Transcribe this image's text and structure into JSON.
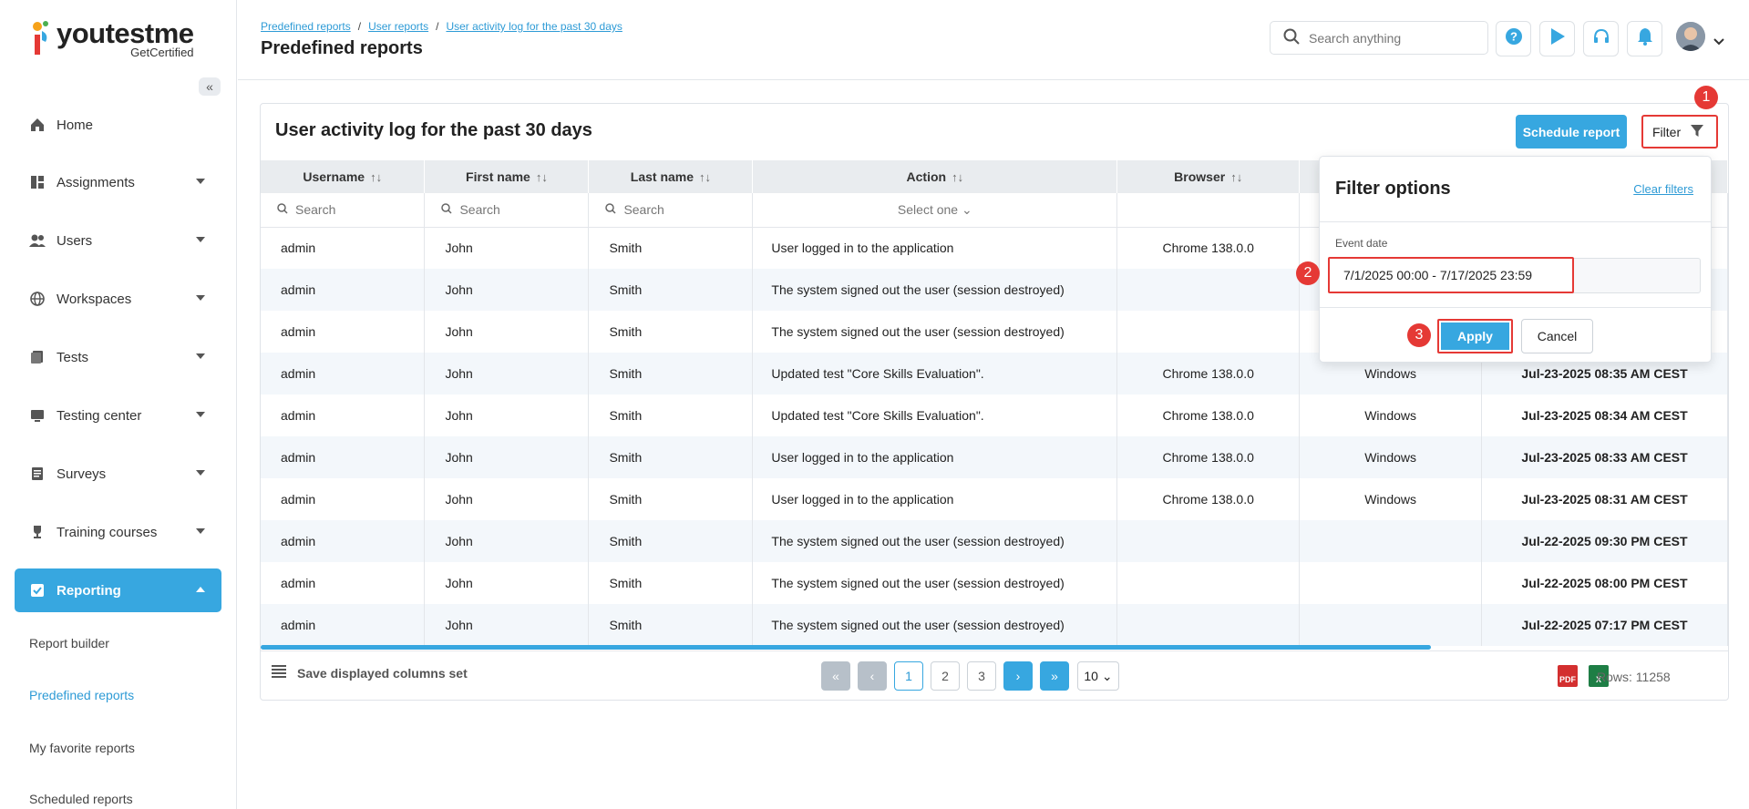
{
  "brand": {
    "name": "youtestme",
    "sub": "GetCertified",
    "accent": "#37a7e0",
    "highlight": "#e53935"
  },
  "sidebar": {
    "collapse_icon": "double-chevron-left-icon",
    "items": [
      {
        "label": "Home",
        "icon": "home-icon"
      },
      {
        "label": "Assignments",
        "icon": "assignments-icon"
      },
      {
        "label": "Users",
        "icon": "users-icon"
      },
      {
        "label": "Workspaces",
        "icon": "globe-icon"
      },
      {
        "label": "Tests",
        "icon": "tests-icon"
      },
      {
        "label": "Testing center",
        "icon": "monitor-icon"
      },
      {
        "label": "Surveys",
        "icon": "survey-icon"
      },
      {
        "label": "Training courses",
        "icon": "trophy-icon"
      },
      {
        "label": "Reporting",
        "icon": "reporting-icon"
      }
    ],
    "sub_items": [
      {
        "label": "Report builder"
      },
      {
        "label": "Predefined reports"
      },
      {
        "label": "My favorite reports"
      },
      {
        "label": "Scheduled reports"
      }
    ]
  },
  "header": {
    "breadcrumb": [
      "Predefined reports",
      "User activity log for the past 30 days"
    ],
    "breadcrumb_mid": "User reports",
    "title": "Predefined reports",
    "search_placeholder": "Search anything"
  },
  "report": {
    "title": "User activity log for the past 30 days",
    "schedule_label": "Schedule report",
    "filter_label": "Filter",
    "columns": [
      "Username",
      "First name",
      "Last name",
      "Action",
      "Browser"
    ],
    "search_placeholder": "Search",
    "action_filter": "Select one",
    "rows": [
      [
        "admin",
        "John",
        "Smith",
        "User logged in to the application",
        "Chrome 138.0.0",
        "",
        ""
      ],
      [
        "admin",
        "John",
        "Smith",
        "The system signed out the user (session destroyed)",
        "",
        "",
        ""
      ],
      [
        "admin",
        "John",
        "Smith",
        "The system signed out the user (session destroyed)",
        "",
        "",
        ""
      ],
      [
        "admin",
        "John",
        "Smith",
        "Updated test \"Core Skills Evaluation\".",
        "Chrome 138.0.0",
        "Windows",
        "Jul-23-2025 08:35 AM CEST"
      ],
      [
        "admin",
        "John",
        "Smith",
        "Updated test \"Core Skills Evaluation\".",
        "Chrome 138.0.0",
        "Windows",
        "Jul-23-2025 08:34 AM CEST"
      ],
      [
        "admin",
        "John",
        "Smith",
        "User logged in to the application",
        "Chrome 138.0.0",
        "Windows",
        "Jul-23-2025 08:33 AM CEST"
      ],
      [
        "admin",
        "John",
        "Smith",
        "User logged in to the application",
        "Chrome 138.0.0",
        "Windows",
        "Jul-23-2025 08:31 AM CEST"
      ],
      [
        "admin",
        "John",
        "Smith",
        "The system signed out the user (session destroyed)",
        "",
        "",
        "Jul-22-2025 09:30 PM CEST"
      ],
      [
        "admin",
        "John",
        "Smith",
        "The system signed out the user (session destroyed)",
        "",
        "",
        "Jul-22-2025 08:00 PM CEST"
      ],
      [
        "admin",
        "John",
        "Smith",
        "The system signed out the user (session destroyed)",
        "",
        "",
        "Jul-22-2025 07:17 PM CEST"
      ]
    ],
    "save_columns_label": "Save displayed columns set",
    "pages": [
      "1",
      "2",
      "3"
    ],
    "current_page": "1",
    "page_size": "10",
    "rows_total": "Rows: 11258"
  },
  "filter_popup": {
    "title": "Filter options",
    "clear_label": "Clear filters",
    "event_date_label": "Event date",
    "event_date_value": "7/1/2025 00:00 - 7/17/2025 23:59",
    "apply_label": "Apply",
    "cancel_label": "Cancel"
  },
  "annotations": [
    "1",
    "2",
    "3"
  ]
}
